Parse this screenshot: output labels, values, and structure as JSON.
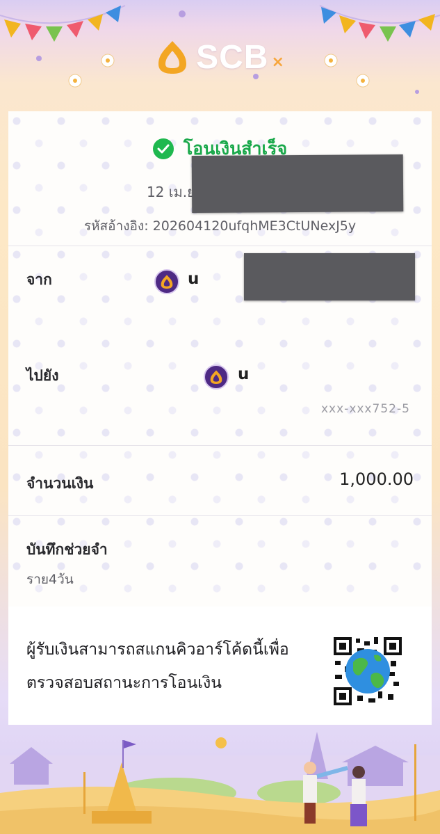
{
  "brand": {
    "name": "SCB",
    "mark": "×"
  },
  "status": {
    "text": "โอนเงินสำเร็จ"
  },
  "transaction": {
    "datetime": "12 เม.ย. 2569 - 16:19",
    "reference_label": "รหัสอ้างอิง:",
    "reference_value": "202604120ufqhME3CtUNexJ5y"
  },
  "from": {
    "label": "จาก",
    "name_visible": "u",
    "name_tail": "u"
  },
  "to": {
    "label": "ไปยัง",
    "name_visible": "u",
    "account_tail": "xxx-xxx752-5"
  },
  "amount": {
    "label": "จำนวนเงิน",
    "value": "1,000.00"
  },
  "memo": {
    "label": "บันทึกช่วยจำ",
    "value": "ราย4วัน"
  },
  "qr": {
    "text": "ผู้รับเงินสามารถสแกนคิวอาร์โค้ดนี้เพื่อตรวจสอบสถานะการโอนเงิน"
  },
  "colors": {
    "success_green": "#1fb84f",
    "brand_purple": "#4e2a84",
    "redaction_gray": "#5a5a5e"
  }
}
